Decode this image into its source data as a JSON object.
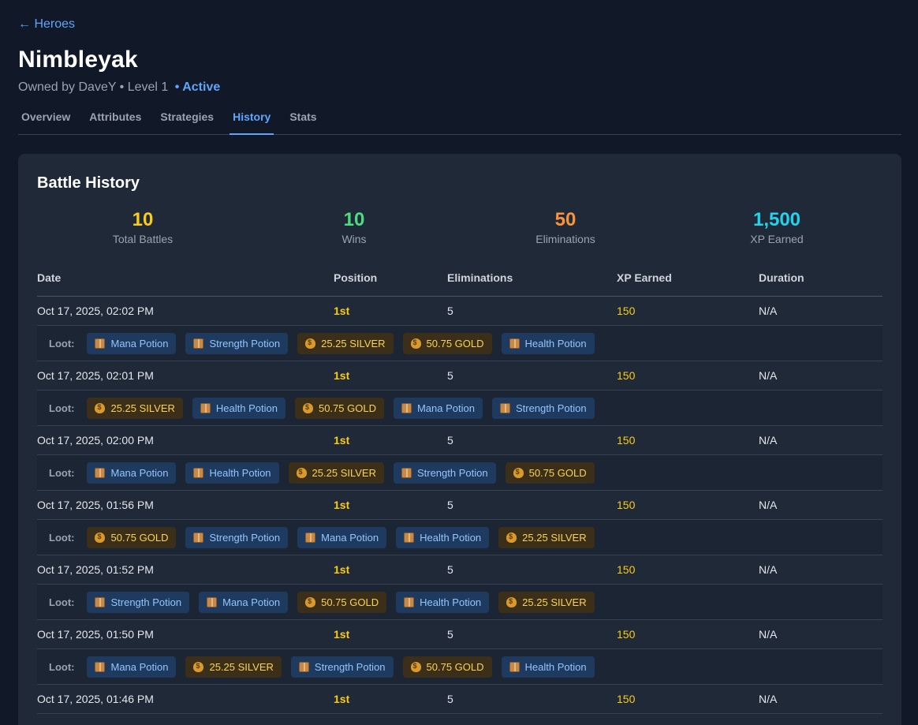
{
  "nav": {
    "back_label": "← Heroes"
  },
  "hero": {
    "name": "Nimbleyak",
    "subline": "Owned by DaveY • Level 1",
    "status": "• Active"
  },
  "tabs": [
    {
      "label": "Overview",
      "active": false
    },
    {
      "label": "Attributes",
      "active": false
    },
    {
      "label": "Strategies",
      "active": false
    },
    {
      "label": "History",
      "active": true
    },
    {
      "label": "Stats",
      "active": false
    }
  ],
  "history": {
    "title": "Battle History",
    "summary": [
      {
        "value": "10",
        "label": "Total Battles",
        "color": "#facc15"
      },
      {
        "value": "10",
        "label": "Wins",
        "color": "#4ade80"
      },
      {
        "value": "50",
        "label": "Eliminations",
        "color": "#fb923c"
      },
      {
        "value": "1,500",
        "label": "XP Earned",
        "color": "#22d3ee"
      }
    ],
    "columns": [
      "Date",
      "Position",
      "Eliminations",
      "XP Earned",
      "Duration"
    ],
    "loot_label": "Loot:",
    "battles": [
      {
        "date": "Oct 17, 2025, 02:02 PM",
        "position": "1st",
        "eliminations": "5",
        "xp": "150",
        "duration": "N/A",
        "loot": [
          {
            "type": "item",
            "icon": "crate-icon",
            "label": "Mana Potion"
          },
          {
            "type": "item",
            "icon": "crate-icon",
            "label": "Strength Potion"
          },
          {
            "type": "currency",
            "icon": "money-bag-icon",
            "label": "25.25 SILVER"
          },
          {
            "type": "currency",
            "icon": "money-bag-icon",
            "label": "50.75 GOLD"
          },
          {
            "type": "item",
            "icon": "crate-icon",
            "label": "Health Potion"
          }
        ]
      },
      {
        "date": "Oct 17, 2025, 02:01 PM",
        "position": "1st",
        "eliminations": "5",
        "xp": "150",
        "duration": "N/A",
        "loot": [
          {
            "type": "currency",
            "icon": "money-bag-icon",
            "label": "25.25 SILVER"
          },
          {
            "type": "item",
            "icon": "crate-icon",
            "label": "Health Potion"
          },
          {
            "type": "currency",
            "icon": "money-bag-icon",
            "label": "50.75 GOLD"
          },
          {
            "type": "item",
            "icon": "crate-icon",
            "label": "Mana Potion"
          },
          {
            "type": "item",
            "icon": "crate-icon",
            "label": "Strength Potion"
          }
        ]
      },
      {
        "date": "Oct 17, 2025, 02:00 PM",
        "position": "1st",
        "eliminations": "5",
        "xp": "150",
        "duration": "N/A",
        "loot": [
          {
            "type": "item",
            "icon": "crate-icon",
            "label": "Mana Potion"
          },
          {
            "type": "item",
            "icon": "crate-icon",
            "label": "Health Potion"
          },
          {
            "type": "currency",
            "icon": "money-bag-icon",
            "label": "25.25 SILVER"
          },
          {
            "type": "item",
            "icon": "crate-icon",
            "label": "Strength Potion"
          },
          {
            "type": "currency",
            "icon": "money-bag-icon",
            "label": "50.75 GOLD"
          }
        ]
      },
      {
        "date": "Oct 17, 2025, 01:56 PM",
        "position": "1st",
        "eliminations": "5",
        "xp": "150",
        "duration": "N/A",
        "loot": [
          {
            "type": "currency",
            "icon": "money-bag-icon",
            "label": "50.75 GOLD"
          },
          {
            "type": "item",
            "icon": "crate-icon",
            "label": "Strength Potion"
          },
          {
            "type": "item",
            "icon": "crate-icon",
            "label": "Mana Potion"
          },
          {
            "type": "item",
            "icon": "crate-icon",
            "label": "Health Potion"
          },
          {
            "type": "currency",
            "icon": "money-bag-icon",
            "label": "25.25 SILVER"
          }
        ]
      },
      {
        "date": "Oct 17, 2025, 01:52 PM",
        "position": "1st",
        "eliminations": "5",
        "xp": "150",
        "duration": "N/A",
        "loot": [
          {
            "type": "item",
            "icon": "crate-icon",
            "label": "Strength Potion"
          },
          {
            "type": "item",
            "icon": "crate-icon",
            "label": "Mana Potion"
          },
          {
            "type": "currency",
            "icon": "money-bag-icon",
            "label": "50.75 GOLD"
          },
          {
            "type": "item",
            "icon": "crate-icon",
            "label": "Health Potion"
          },
          {
            "type": "currency",
            "icon": "money-bag-icon",
            "label": "25.25 SILVER"
          }
        ]
      },
      {
        "date": "Oct 17, 2025, 01:50 PM",
        "position": "1st",
        "eliminations": "5",
        "xp": "150",
        "duration": "N/A",
        "loot": [
          {
            "type": "item",
            "icon": "crate-icon",
            "label": "Mana Potion"
          },
          {
            "type": "currency",
            "icon": "money-bag-icon",
            "label": "25.25 SILVER"
          },
          {
            "type": "item",
            "icon": "crate-icon",
            "label": "Strength Potion"
          },
          {
            "type": "currency",
            "icon": "money-bag-icon",
            "label": "50.75 GOLD"
          },
          {
            "type": "item",
            "icon": "crate-icon",
            "label": "Health Potion"
          }
        ]
      },
      {
        "date": "Oct 17, 2025, 01:46 PM",
        "position": "1st",
        "eliminations": "5",
        "xp": "150",
        "duration": "N/A",
        "loot": []
      }
    ]
  }
}
